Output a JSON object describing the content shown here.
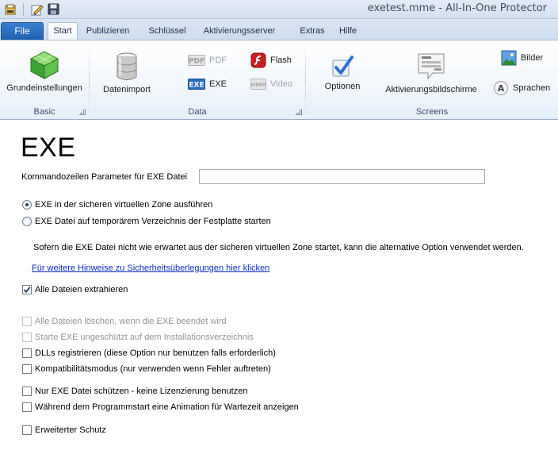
{
  "window": {
    "title": "exetest.mme - All-In-One Protector"
  },
  "quick_access": {
    "icons": [
      "app-menu-icon",
      "edit-icon",
      "save-icon"
    ]
  },
  "tabs": {
    "file": "File",
    "items": [
      {
        "label": "Start",
        "active": true
      },
      {
        "label": "Publizieren",
        "active": false
      },
      {
        "label": "Schlüssel",
        "active": false
      },
      {
        "label": "Aktivierungsserver",
        "active": false
      },
      {
        "label": "Extras",
        "active": false
      },
      {
        "label": "Hilfe",
        "active": false
      }
    ]
  },
  "ribbon": {
    "groups": {
      "basic": {
        "label": "Basic",
        "grundeinstellungen": "Grundeinstellungen"
      },
      "data": {
        "label": "Data",
        "datenimport": "Datenimport",
        "pdf": "PDF",
        "exe": "EXE",
        "flash": "Flash",
        "video": "Video"
      },
      "screens": {
        "label": "Screens",
        "optionen": "Optionen",
        "aktivierungsbildschirme": "Aktivierungsbildschirme",
        "bilder": "Bilder",
        "sprachen": "Sprachen"
      }
    }
  },
  "page": {
    "heading": "EXE",
    "cmd_label": "Kommandozeilen Parameter für EXE Datei",
    "cmd_value": "",
    "radio_virtual": "EXE in der sicheren virtuellen Zone ausführen",
    "radio_temp": "EXE Datei auf temporärem Verzeichnis der Festplatte starten",
    "info_text": "Sofern die EXE Datei nicht wie erwartet aus der sicheren virtuellen Zone startet, kann die alternative Option verwendet werden.",
    "info_link": "Für weitere Hinweise zu Sicherheitsüberlegungen hier klicken",
    "chk_extract": "Alle Dateien extrahieren",
    "chk_delete": "Alle Dateien löschen, wenn die EXE beendet wird",
    "chk_unprotected": "Starte EXE ungeschützt auf dem Installationsverzeichnis",
    "chk_dlls": "DLLs registrieren (diese Option nur benutzen falls erforderlich)",
    "chk_compat": "Kompatibilitätsmodus (nur verwenden wenn Fehler auftreten)",
    "chk_nolicense": "Nur EXE Datei schützen - keine Lizenzierung benutzen",
    "chk_animation": "Während dem Programmstart eine Animation für Wartezeit anzeigen",
    "chk_extended": "Erweiterter Schutz"
  }
}
